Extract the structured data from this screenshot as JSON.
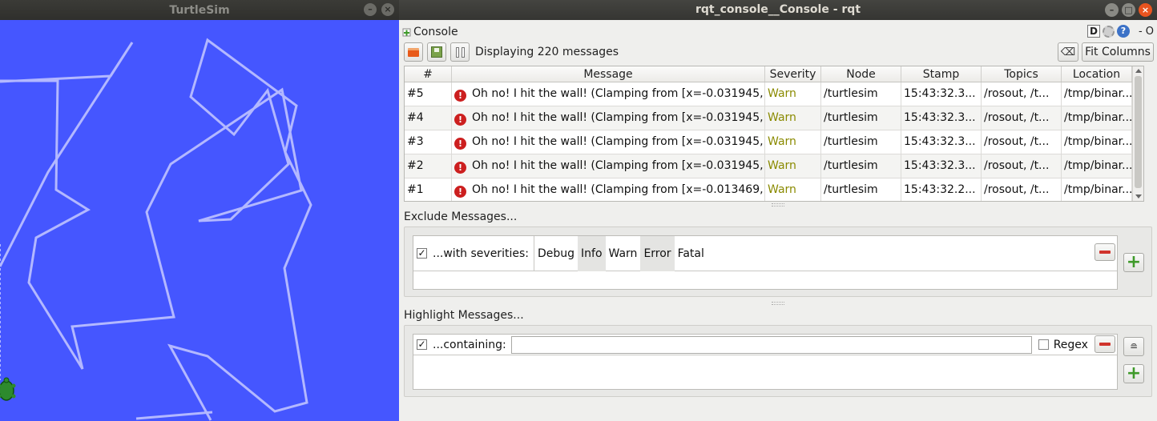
{
  "turtlesim": {
    "title": "TurtleSim",
    "minimize_glyph": "–",
    "close_glyph": "×",
    "background_color": "#4556ff",
    "pen_color": "#b3b8ff"
  },
  "rqt": {
    "title": "rqt_console__Console - rqt",
    "window_buttons": [
      "–",
      "□",
      "×"
    ],
    "plugin_label": "Console",
    "header_right": {
      "d_label": "D",
      "help_label": "?",
      "dash_label": "- O"
    },
    "toolbar": {
      "display_count": "Displaying 220 messages",
      "clear_glyph": "⌫",
      "fit_columns_label": "Fit Columns"
    },
    "table": {
      "columns": [
        "#",
        "Message",
        "Severity",
        "Node",
        "Stamp",
        "Topics",
        "Location"
      ],
      "rows": [
        {
          "num": "#5",
          "message": "Oh no! I hit the wall! (Clamping from [x=-0.031945, ...",
          "severity": "Warn",
          "node": "/turtlesim",
          "stamp": "15:43:32.3...",
          "topics": "/rosout, /t...",
          "location": "/tmp/binar..."
        },
        {
          "num": "#4",
          "message": "Oh no! I hit the wall! (Clamping from [x=-0.031945, ...",
          "severity": "Warn",
          "node": "/turtlesim",
          "stamp": "15:43:32.3...",
          "topics": "/rosout, /t...",
          "location": "/tmp/binar..."
        },
        {
          "num": "#3",
          "message": "Oh no! I hit the wall! (Clamping from [x=-0.031945, ...",
          "severity": "Warn",
          "node": "/turtlesim",
          "stamp": "15:43:32.3...",
          "topics": "/rosout, /t...",
          "location": "/tmp/binar..."
        },
        {
          "num": "#2",
          "message": "Oh no! I hit the wall! (Clamping from [x=-0.031945, ...",
          "severity": "Warn",
          "node": "/turtlesim",
          "stamp": "15:43:32.3...",
          "topics": "/rosout, /t...",
          "location": "/tmp/binar..."
        },
        {
          "num": "#1",
          "message": "Oh no! I hit the wall! (Clamping from [x=-0.013469, ...",
          "severity": "Warn",
          "node": "/turtlesim",
          "stamp": "15:43:32.2...",
          "topics": "/rosout, /t...",
          "location": "/tmp/binar..."
        }
      ],
      "severity_color": "#8a8a00",
      "error_glyph": "!"
    },
    "exclude": {
      "label": "Exclude Messages...",
      "row_label": "...with severities:",
      "checked_glyph": "✓",
      "severities": [
        "Debug",
        "Info",
        "Warn",
        "Error",
        "Fatal"
      ],
      "selected": [
        "Info",
        "Error"
      ]
    },
    "highlight": {
      "label": "Highlight Messages...",
      "row_label": "...containing:",
      "checked_glyph": "✓",
      "input_value": "",
      "regex_label": "Regex"
    },
    "plus_glyph": "+"
  }
}
